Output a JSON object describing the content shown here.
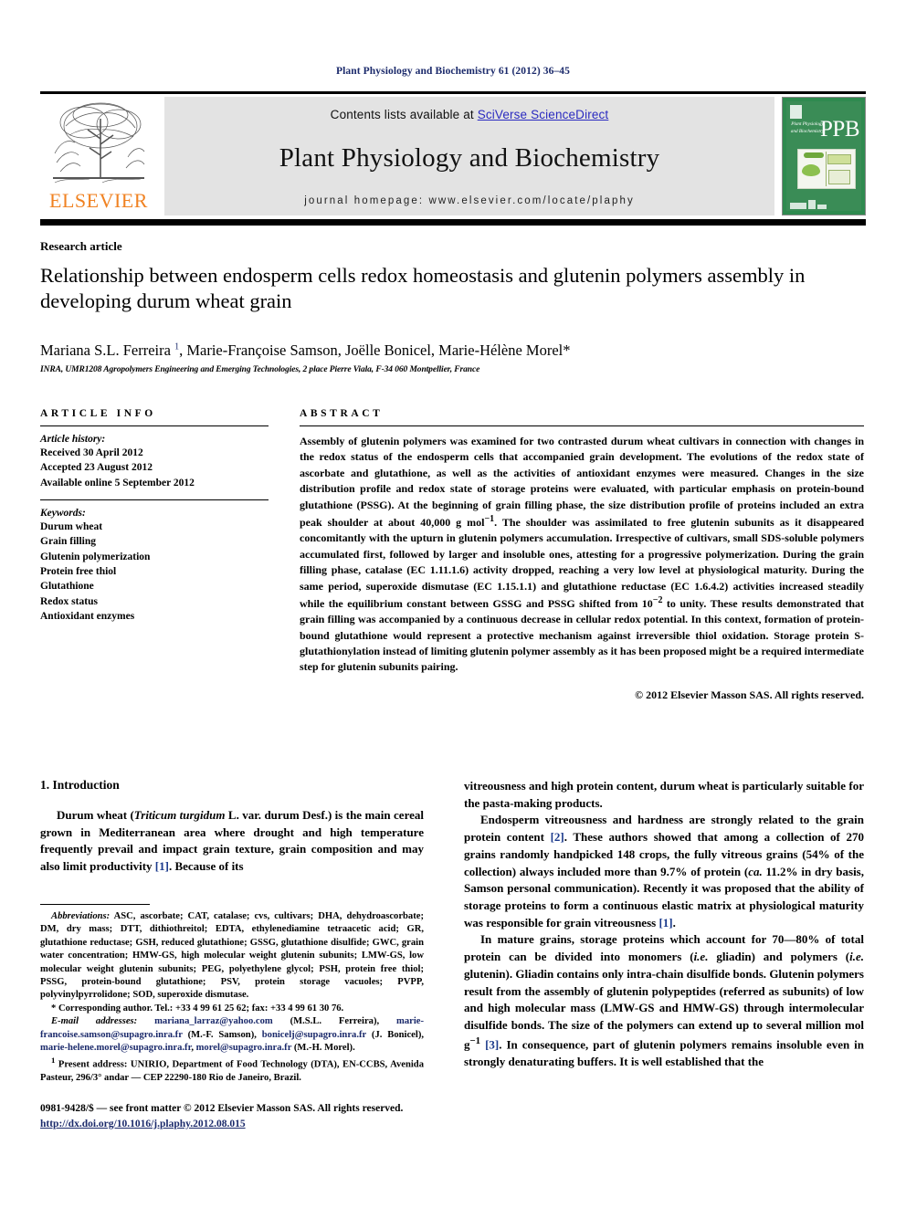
{
  "running_head": "Plant Physiology and Biochemistry 61 (2012) 36–45",
  "masthead": {
    "contents_prefix": "Contents lists available at ",
    "sciencedirect_link": "SciVerse ScienceDirect",
    "journal_title": "Plant Physiology and Biochemistry",
    "homepage": "journal homepage: www.elsevier.com/locate/plaphy",
    "publisher_logo_text": "ELSEVIER",
    "cover": {
      "acronym": "PPB",
      "title_lines": "Plant Physiology and Biochemistry"
    },
    "colors": {
      "link": "#2a2ac0",
      "elsevier_orange": "#f08222",
      "cover_green": "#2f8a4f",
      "band_grey": "#e3e3e3"
    }
  },
  "article": {
    "type": "Research article",
    "title": "Relationship between endosperm cells redox homeostasis and glutenin polymers assembly in developing durum wheat grain",
    "authors_html": "Mariana S.L. Ferreira <sup>1</sup>, Marie-Françoise Samson, Joëlle Bonicel, Marie-Hélène Morel<span class=\"star\">*</span>",
    "affiliation": "INRA, UMR1208 Agropolymers Engineering and Emerging Technologies, 2 place Pierre Viala, F-34 060 Montpellier, France"
  },
  "article_info": {
    "heading": "ARTICLE INFO",
    "history_label": "Article history:",
    "history": [
      "Received 30 April 2012",
      "Accepted 23 August 2012",
      "Available online 5 September 2012"
    ],
    "keywords_label": "Keywords:",
    "keywords": [
      "Durum wheat",
      "Grain filling",
      "Glutenin polymerization",
      "Protein free thiol",
      "Glutathione",
      "Redox status",
      "Antioxidant enzymes"
    ]
  },
  "abstract": {
    "heading": "ABSTRACT",
    "text_html": "Assembly of glutenin polymers was examined for two contrasted durum wheat cultivars in connection with changes in the redox status of the endosperm cells that accompanied grain development. The evolutions of the redox state of ascorbate and glutathione, as well as the activities of antioxidant enzymes were measured. Changes in the size distribution profile and redox state of storage proteins were evaluated, with particular emphasis on protein-bound glutathione (PSSG). At the beginning of grain filling phase, the size distribution profile of proteins included an extra peak shoulder at about 40,000 g mol<sup>&minus;1</sup>. The shoulder was assimilated to free glutenin subunits as it disappeared concomitantly with the upturn in glutenin polymers accumulation. Irrespective of cultivars, small SDS-soluble polymers accumulated first, followed by larger and insoluble ones, attesting for a progressive polymerization. During the grain filling phase, catalase (EC 1.11.1.6) activity dropped, reaching a very low level at physiological maturity. During the same period, superoxide dismutase (EC 1.15.1.1) and glutathione reductase (EC 1.6.4.2) activities increased steadily while the equilibrium constant between GSSG and PSSG shifted from 10<sup>&minus;2</sup> to unity. These results demonstrated that grain filling was accompanied by a continuous decrease in cellular redox potential. In this context, formation of protein-bound glutathione would represent a protective mechanism against irreversible thiol oxidation. Storage protein S-glutathionylation instead of limiting glutenin polymer assembly as it has been proposed might be a required intermediate step for glutenin subunits pairing.",
    "copyright": "© 2012 Elsevier Masson SAS. All rights reserved."
  },
  "body": {
    "section_heading": "1. Introduction",
    "left_para_html": "Durum wheat (<span class=\"it\">Triticum turgidum</span> L. var. durum Desf.) is the main cereal grown in Mediterranean area where drought and high temperature frequently prevail and impact grain texture, grain composition and may also limit productivity <span class=\"ref\">[1]</span>. Because of its",
    "right_paras_html": [
      "vitreousness and high protein content, durum wheat is particularly suitable for the pasta-making products.",
      "Endosperm vitreousness and hardness are strongly related to the grain protein content <span class=\"ref\">[2]</span>. These authors showed that among a collection of 270 grains randomly handpicked 148 crops, the fully vitreous grains (54% of the collection) always included more than 9.7% of protein (<span class=\"it\">ca.</span> 11.2% in dry basis, Samson personal communication). Recently it was proposed that the ability of storage proteins to form a continuous elastic matrix at physiological maturity was responsible for grain vitreousness <span class=\"ref\">[1]</span>.",
      "In mature grains, storage proteins which account for 70—80% of total protein can be divided into monomers (<span class=\"it\">i.e.</span> gliadin) and polymers (<span class=\"it\">i.e.</span> glutenin). Gliadin contains only intra-chain disulfide bonds. Glutenin polymers result from the assembly of glutenin polypeptides (referred as subunits) of low and high molecular mass (LMW-GS and HMW-GS) through intermolecular disulfide bonds. The size of the polymers can extend up to several million mol g<sup>&minus;1</sup> <span class=\"ref\">[3]</span>. In consequence, part of glutenin polymers remains insoluble even in strongly denaturating buffers. It is well established that the"
    ]
  },
  "footnotes": {
    "abbreviations_html": "<span class=\"it\">Abbreviations:</span> ASC, ascorbate; CAT, catalase; cvs, cultivars; DHA, dehydroascorbate; DM, dry mass; DTT, dithiothreitol; EDTA, ethylenediamine tetraacetic acid; GR, glutathione reductase; GSH, reduced glutathione; GSSG, glutathione disulfide; GWC, grain water concentration; HMW-GS, high molecular weight glutenin subunits; LMW-GS, low molecular weight glutenin subunits; PEG, polyethylene glycol; PSH, protein free thiol; PSSG, protein-bound glutathione; PSV, protein storage vacuoles; PVPP, polyvinylpyrrolidone; SOD, superoxide dismutase.",
    "corresponding_html": "* Corresponding author. Tel.: +33 4 99 61 25 62; fax: +33 4 99 61 30 76.",
    "emails_html": "<span class=\"it\">E-mail addresses:</span> <span class=\"fn-mail\">mariana_larraz@yahoo.com</span> (M.S.L. Ferreira), <span class=\"fn-mail\">marie-francoise.samson@supagro.inra.fr</span> (M.-F. Samson), <span class=\"fn-mail\">bonicelj@supagro.inra.fr</span> (J. Bonicel), <span class=\"fn-mail\">marie-helene.morel@supagro.inra.fr</span>, <span class=\"fn-mail\">morel@supagro.inra.fr</span> (M.-H. Morel).",
    "present_address_html": "<sup>1</sup> Present address: UNIRIO, Department of Food Technology (DTA), EN-CCBS, Avenida Pasteur, 296/3° andar — CEP 22290-180 Rio de Janeiro, Brazil."
  },
  "publisher_footer": {
    "line1": "0981-9428/$ — see front matter © 2012 Elsevier Masson SAS. All rights reserved.",
    "doi": "http://dx.doi.org/10.1016/j.plaphy.2012.08.015"
  }
}
